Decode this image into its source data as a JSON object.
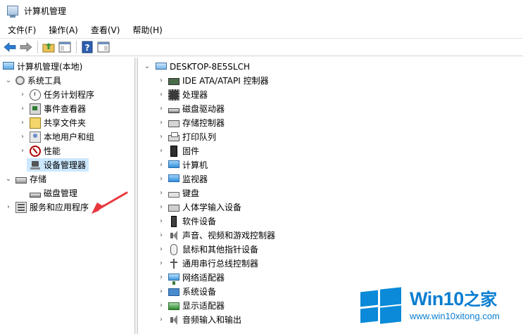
{
  "window": {
    "title": "计算机管理"
  },
  "menu": [
    "文件(F)",
    "操作(A)",
    "查看(V)",
    "帮助(H)"
  ],
  "toolbar": {
    "buttons": [
      "back-icon",
      "forward-icon",
      "up-folder-icon",
      "show-hide-tree-icon",
      "help-icon",
      "properties-pane-icon"
    ]
  },
  "tree": {
    "root": "计算机管理(本地)",
    "system_tools": "系统工具",
    "task_scheduler": "任务计划程序",
    "event_viewer": "事件查看器",
    "shared_folders": "共享文件夹",
    "local_users": "本地用户和组",
    "performance": "性能",
    "device_manager": "设备管理器",
    "storage": "存储",
    "disk_management": "磁盘管理",
    "services_apps": "服务和应用程序"
  },
  "devices": {
    "computer_name": "DESKTOP-8E5SLCH",
    "categories": [
      "IDE ATA/ATAPI 控制器",
      "处理器",
      "磁盘驱动器",
      "存储控制器",
      "打印队列",
      "固件",
      "计算机",
      "监视器",
      "键盘",
      "人体学输入设备",
      "软件设备",
      "声音、视频和游戏控制器",
      "鼠标和其他指针设备",
      "通用串行总线控制器",
      "网络适配器",
      "系统设备",
      "显示适配器",
      "音频输入和输出"
    ]
  },
  "watermark": {
    "brand": "Win10",
    "brand_suffix": "之家",
    "url": "www.win10xitong.com"
  },
  "colors": {
    "selection": "#cce8ff",
    "annotation_arrow": "#e8383d",
    "watermark_blue": "#0a8ad8"
  }
}
